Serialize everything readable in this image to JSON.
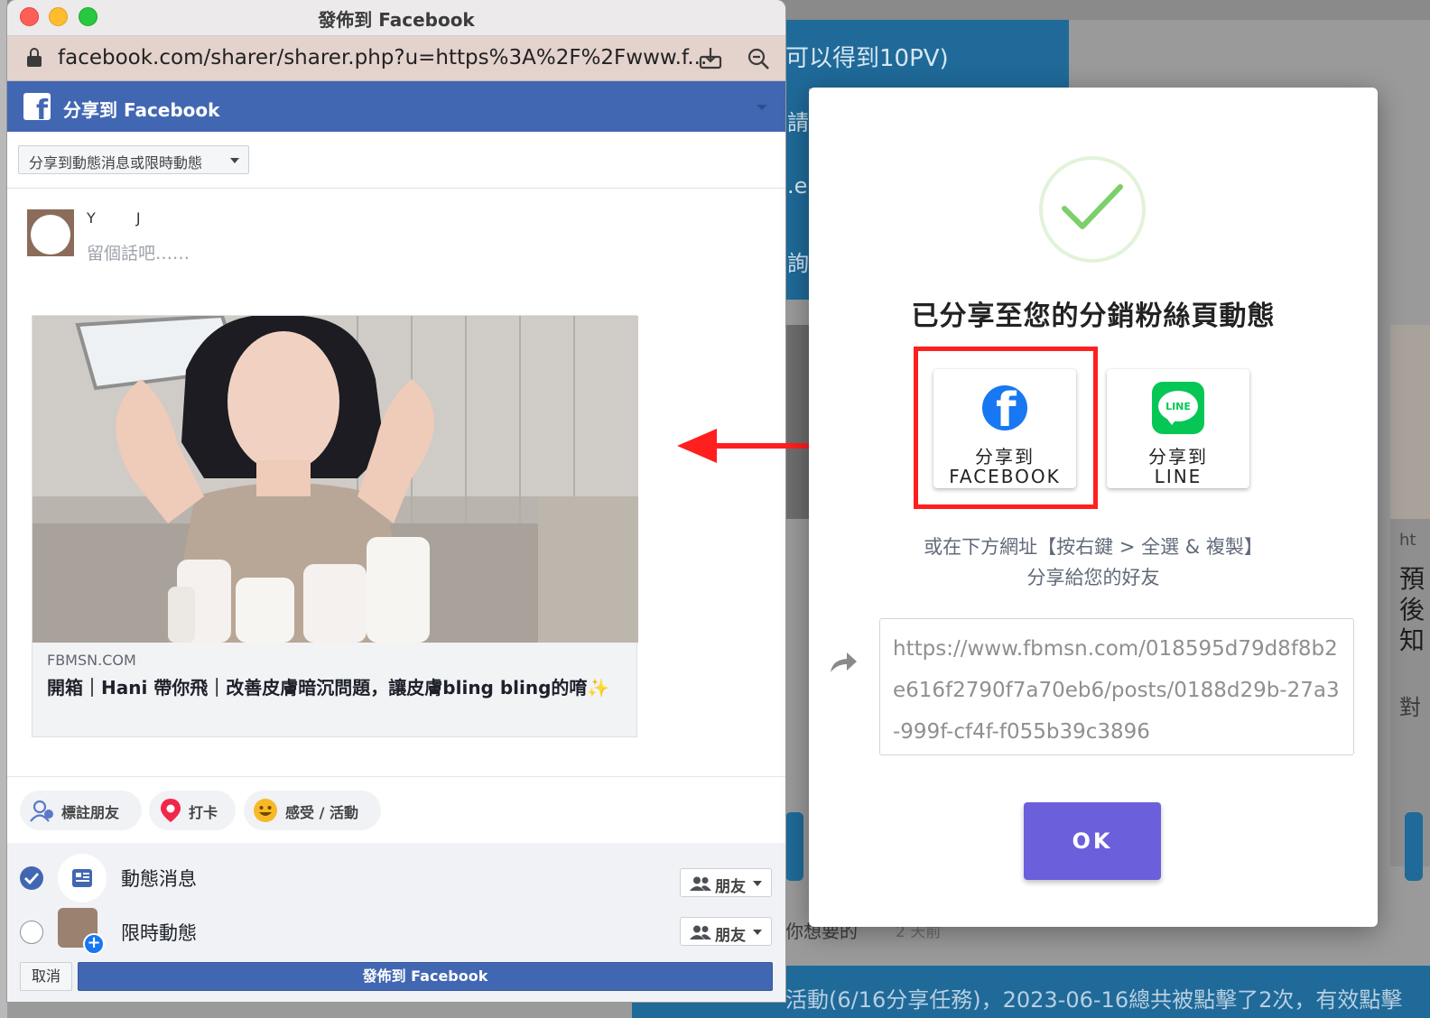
{
  "background": {
    "banner_text": "可以得到10PV)",
    "side_glyphs": [
      "請",
      ".e",
      "詢"
    ],
    "bottom_text": "活動(6/16分享任務)，2023-06-16總共被點擊了2次，有效點擊",
    "mid_glyph_1": "你想要的",
    "mid_glyph_2": "2 天前",
    "right_card_glyphs": [
      "預",
      "後",
      "知"
    ],
    "right_card_small": "ht",
    "right_card_foot": "對"
  },
  "popup": {
    "window_title": "發佈到 Facebook",
    "url": "facebook.com/sharer/sharer.php?u=https%3A%2F%2Fwww.f...",
    "header_title": "分享到 Facebook",
    "share_target_label": "分享到動態消息或限時動態",
    "user_name": "Y    J",
    "compose_placeholder": "留個話吧……",
    "preview": {
      "domain": "FBMSN.COM",
      "title": "開箱｜Hani 帶你飛｜改善皮膚暗沉問題，讓皮膚bling bling的唷✨"
    },
    "actions": [
      {
        "label": "標註朋友",
        "icon": "tag-friends-icon"
      },
      {
        "label": "打卡",
        "icon": "location-pin-icon"
      },
      {
        "label": "感受 / 活動",
        "icon": "smiley-icon"
      }
    ],
    "audiences": [
      {
        "label": "動態消息",
        "selected": true,
        "privacy": "朋友"
      },
      {
        "label": "限時動態",
        "selected": false,
        "privacy": "朋友"
      }
    ],
    "cancel_label": "取消",
    "post_label": "發佈到 Facebook"
  },
  "modal": {
    "title": "已分享至您的分銷粉絲頁動態",
    "share_facebook_label": "分享到\nFACEBOOK",
    "share_line_label": "分享到\nLINE",
    "line_icon_text": "LINE",
    "hint": "或在下方網址【按右鍵 > 全選 & 複製】\n分享給您的好友",
    "share_url": "https://www.fbmsn.com/018595d79d8f8b2e616f2790f7a70eb6/posts/0188d29b-27a3-999f-cf4f-f055b39c3896",
    "ok_label": "OK"
  },
  "colors": {
    "facebook_blue": "#4267b2",
    "line_green": "#06c755",
    "ok_purple": "#6b5fdb",
    "highlight_red": "#ff1f1f",
    "success_green": "#7ccf6a"
  }
}
